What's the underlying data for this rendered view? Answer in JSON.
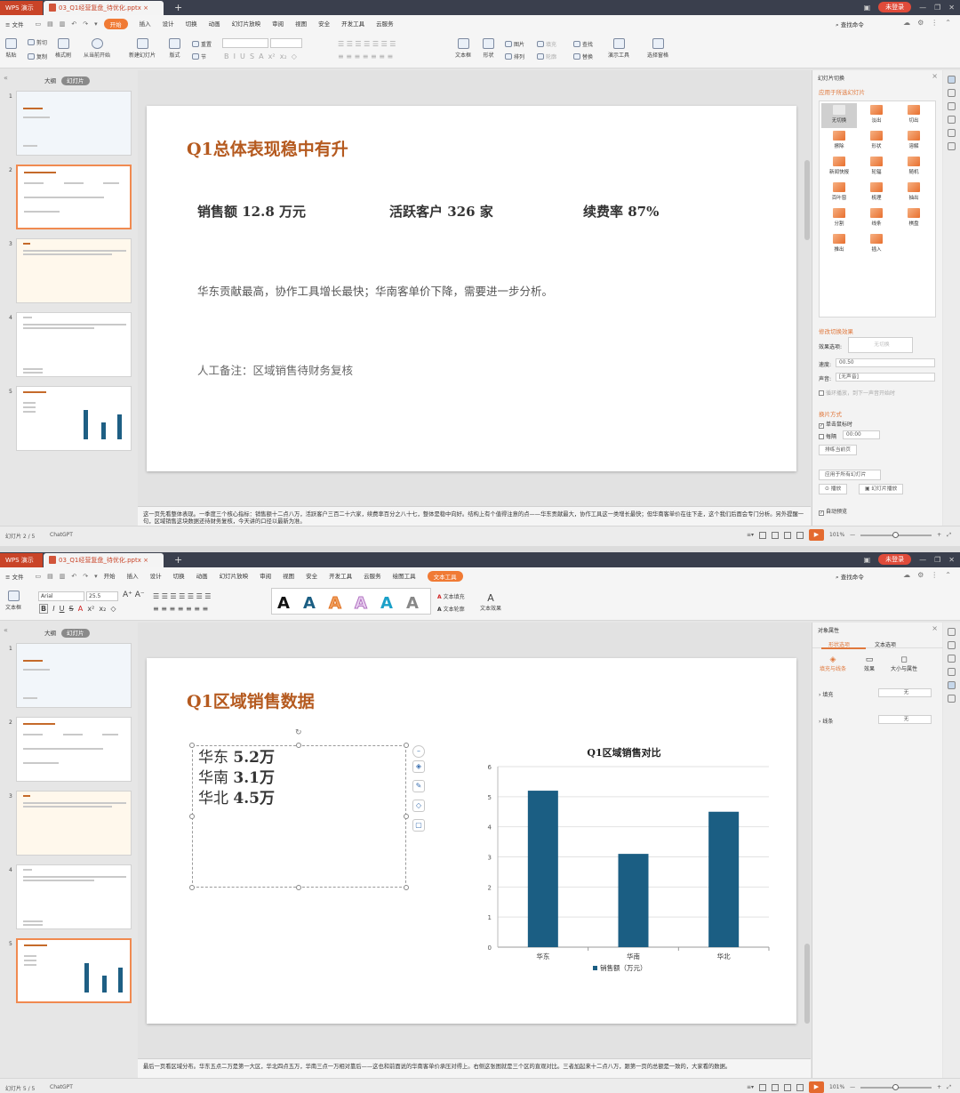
{
  "app": {
    "brand": "WPS 演示",
    "login": "未登录",
    "search": "查找命令"
  },
  "qat": [
    "≡ 文件"
  ],
  "ribbon_top": {
    "clipboard": [
      "粘贴",
      "剪切",
      "复制",
      "格式刷",
      "从当前开始"
    ],
    "slides": [
      "新建幻灯片",
      "版式",
      "重置",
      "节"
    ],
    "insert": [
      "文本框",
      "形状",
      "排列",
      "图片",
      "填充",
      "轮廓",
      "查找",
      "替换",
      "演示工具",
      "选择窗格"
    ]
  },
  "window1": {
    "file_tab": "03_Q1经营复盘_待优化.pptx",
    "menus": [
      "开始",
      "插入",
      "设计",
      "切换",
      "动画",
      "幻灯片放映",
      "审阅",
      "视图",
      "安全",
      "开发工具",
      "云服务"
    ],
    "active_menu": "开始",
    "panel_tabs": {
      "outline": "大纲",
      "slides": "幻灯片"
    },
    "slide": {
      "title": "Q1总体表现稳中有升",
      "kpis": [
        "销售额 12.8 万元",
        "活跃客户 326 家",
        "续费率 87%"
      ],
      "summary": "华东贡献最高，协作工具增长最快；华南客单价下降，需要进一步分析。",
      "note": "人工备注：区域销售待财务复核"
    },
    "notes": "这一页先看整体表现。一季度三个核心指标：销售额十二点八万，活跃客户三百二十六家，续费率百分之八十七，整体是稳中向好。结构上有个值得注意的点——华东贡献最大，协作工具这一类增长最快；但华南客单价在往下走，这个我们后面会专门分析。另外提醒一句，区域销售这块数据还待财务复核，今天讲的口径以最新为准。",
    "status": {
      "page": "幻灯片 2 / 5",
      "theme": "ChatGPT",
      "zoom": "101%"
    },
    "pane": {
      "title": "幻灯片切换",
      "apply_selected": "应用于所选幻灯片",
      "transitions": [
        "无切换",
        "淡出",
        "切出",
        "擦除",
        "形状",
        "溶解",
        "新闻快报",
        "轮辐",
        "随机",
        "百叶窗",
        "梳理",
        "抽出",
        "分割",
        "线条",
        "棋盘",
        "推出",
        "插入"
      ],
      "modify": "修改切换效果",
      "effect_label": "效果选项:",
      "effect_value": "无切换",
      "speed_label": "速度:",
      "speed_value": "00.50",
      "sound_label": "声音:",
      "sound_value": "[无声音]",
      "loop": "循环播放，到下一声音开始时",
      "advance": "换片方式",
      "on_click": "单击鼠标时",
      "every": "每隔",
      "every_value": "00:00",
      "sort_btn": "排练当前页",
      "apply_all": "应用于所有幻灯片",
      "play": "播放",
      "slideshow": "幻灯片播放",
      "auto_preview": "自动预览"
    }
  },
  "window2": {
    "file_tab": "03_Q1经营复盘_待优化.pptx",
    "menus": [
      "开始",
      "插入",
      "设计",
      "切换",
      "动画",
      "幻灯片放映",
      "审阅",
      "视图",
      "安全",
      "开发工具",
      "云服务",
      "绘图工具",
      "文本工具"
    ],
    "active_menu": "文本工具",
    "font_name": "Arial",
    "font_size": "25.5",
    "text_tools": [
      "文本填充",
      "文本轮廓",
      "文本效果"
    ],
    "panel_tabs": {
      "outline": "大纲",
      "slides": "幻灯片"
    },
    "slide": {
      "title": "Q1区域销售数据",
      "lines": [
        {
          "region": "华东 ",
          "value": "5.2万"
        },
        {
          "region": "华南 ",
          "value": "3.1万"
        },
        {
          "region": "华北 ",
          "value": "4.5万"
        }
      ]
    },
    "notes": "最后一页看区域分布。华东五点二万是第一大区，华北四点五万，华南三点一万相对靠后——这也和前面说的华南客单价承压对得上。右侧这张图就是三个区的直观对比。三者加起来十二点八万，跟第一页的总额是一致的，大家看的数据。",
    "status": {
      "page": "幻灯片 5 / 5",
      "theme": "ChatGPT",
      "zoom": "101%"
    },
    "pane": {
      "title": "对象属性",
      "tabs": [
        "形状选项",
        "文本选项"
      ],
      "subtabs": [
        "填充与线条",
        "效果",
        "大小与属性"
      ],
      "fill_label": "填充",
      "fill_value": "无",
      "line_label": "线条",
      "line_value": "无"
    }
  },
  "chart_data": {
    "type": "bar",
    "title": "Q1区域销售对比",
    "categories": [
      "华东",
      "华南",
      "华北"
    ],
    "series": [
      {
        "name": "销售额（万元）",
        "values": [
          5.2,
          3.1,
          4.5
        ]
      }
    ],
    "ylim": [
      0,
      6
    ],
    "yticks": [
      0,
      1,
      2,
      3,
      4,
      5,
      6
    ],
    "grid": true,
    "legend": "bottom",
    "color": "#1b5e83"
  },
  "colors": {
    "accent": "#f07a34",
    "title": "#b55a1f",
    "bar": "#1b5e83",
    "titlebar": "#3a3f4d"
  }
}
